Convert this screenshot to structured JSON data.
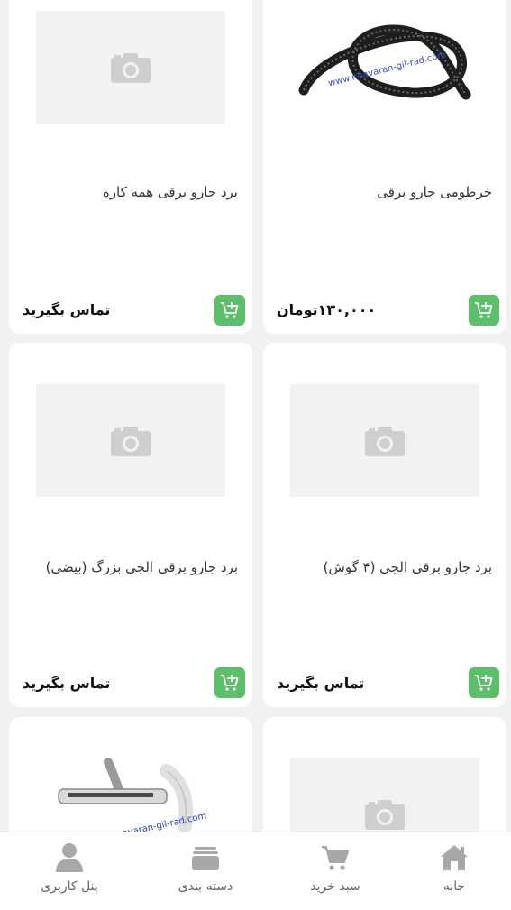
{
  "products": [
    {
      "title": "خرطومی جارو برقی",
      "price": "۱۳۰,۰۰۰تومان",
      "image": "vacuum-hose-photo"
    },
    {
      "title": "برد جارو برقی همه کاره",
      "price": "تماس بگیرید",
      "image": "placeholder"
    },
    {
      "title": "برد جارو برقی الجی (۴ گوش)",
      "price": "تماس بگیرید",
      "image": "placeholder"
    },
    {
      "title": "برد جارو برقی الجی بزرگ (بیضی)",
      "price": "تماس بگیرید",
      "image": "placeholder"
    },
    {
      "title": "",
      "price": "",
      "image": "placeholder"
    },
    {
      "title": "",
      "price": "",
      "image": "vacuum-nozzle-photo"
    }
  ],
  "watermark": "www.noavaran-gil-rad.com",
  "nav": {
    "home": "خانه",
    "cart": "سبد خرید",
    "categories": "دسته بندی",
    "profile": "پنل کاربری"
  },
  "colors": {
    "cart_button": "#5cbf69",
    "background": "#f1f1f1",
    "icon_gray": "#a8a8a8"
  }
}
